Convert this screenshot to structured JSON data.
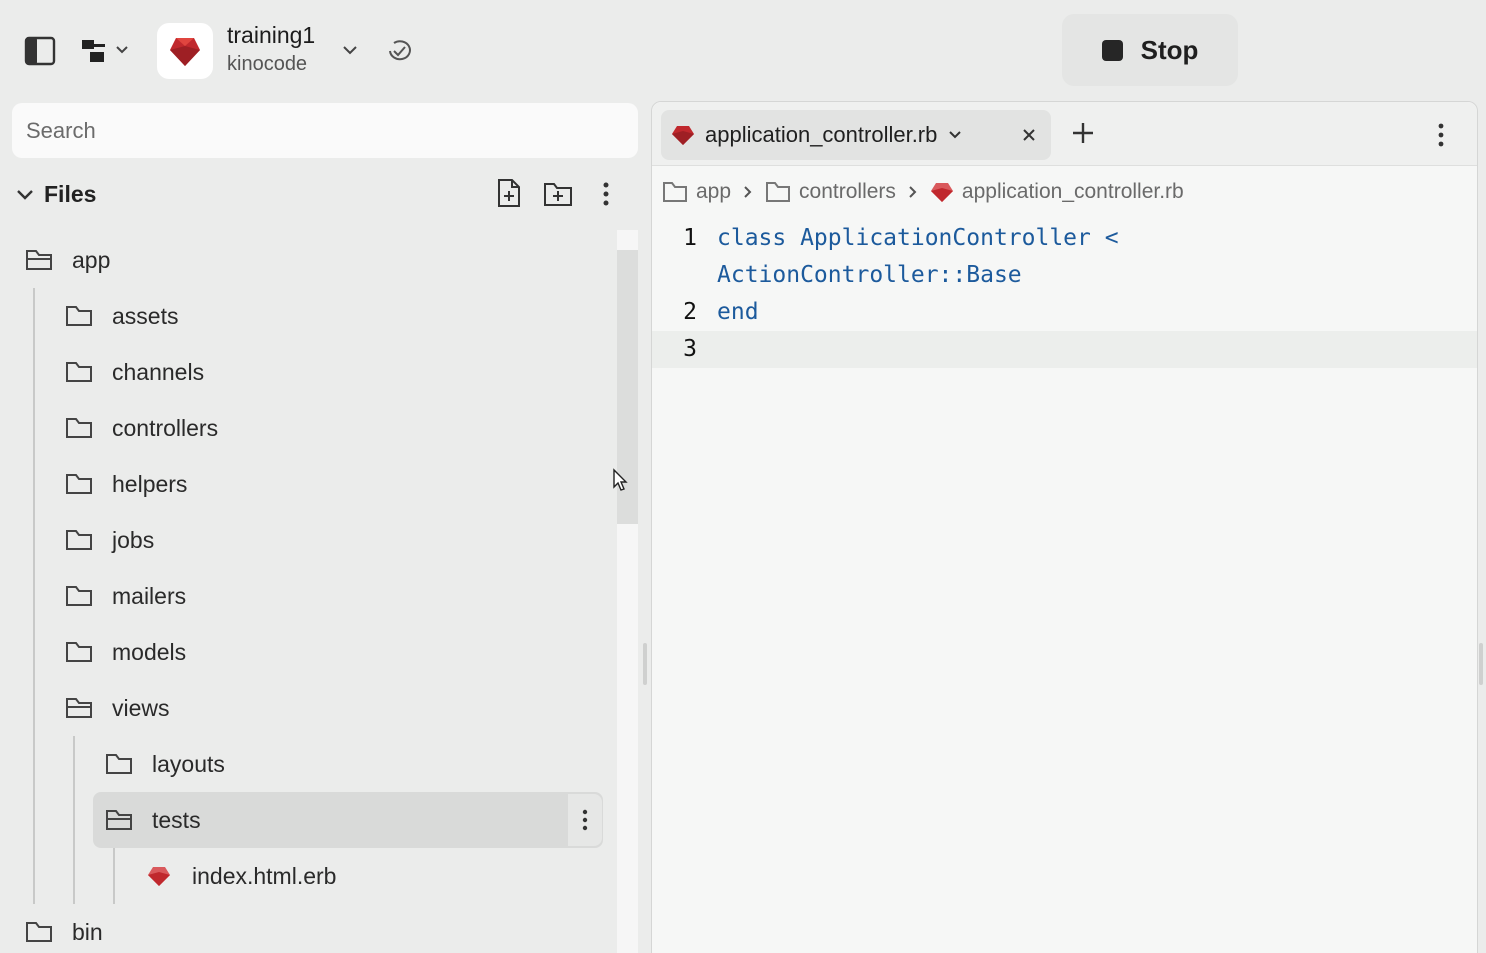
{
  "repl": {
    "name": "training1",
    "owner": "kinocode"
  },
  "run_button": {
    "label": "Stop"
  },
  "search": {
    "placeholder": "Search"
  },
  "files_panel": {
    "title": "Files",
    "tree": [
      {
        "label": "app",
        "type": "folder-open",
        "depth": 0
      },
      {
        "label": "assets",
        "type": "folder",
        "depth": 1
      },
      {
        "label": "channels",
        "type": "folder",
        "depth": 1
      },
      {
        "label": "controllers",
        "type": "folder",
        "depth": 1
      },
      {
        "label": "helpers",
        "type": "folder",
        "depth": 1
      },
      {
        "label": "jobs",
        "type": "folder",
        "depth": 1
      },
      {
        "label": "mailers",
        "type": "folder",
        "depth": 1
      },
      {
        "label": "models",
        "type": "folder",
        "depth": 1
      },
      {
        "label": "views",
        "type": "folder-open",
        "depth": 1
      },
      {
        "label": "layouts",
        "type": "folder",
        "depth": 2
      },
      {
        "label": "tests",
        "type": "folder-open",
        "depth": 2,
        "selected": true
      },
      {
        "label": "index.html.erb",
        "type": "ruby-file",
        "depth": 3
      },
      {
        "label": "bin",
        "type": "folder",
        "depth": 0
      }
    ]
  },
  "editor": {
    "tab": {
      "label": "application_controller.rb",
      "icon": "ruby-icon"
    },
    "breadcrumb": [
      "app",
      "controllers",
      "application_controller.rb"
    ],
    "lines": [
      {
        "number": "1",
        "text": "class ApplicationController <"
      },
      {
        "number": "",
        "text": "ActionController::Base"
      },
      {
        "number": "2",
        "text": "end"
      },
      {
        "number": "3",
        "text": ""
      }
    ]
  },
  "colors": {
    "ruby": "#c0282d",
    "keyword": "#1c5a9c",
    "background": "#ebeceb"
  }
}
